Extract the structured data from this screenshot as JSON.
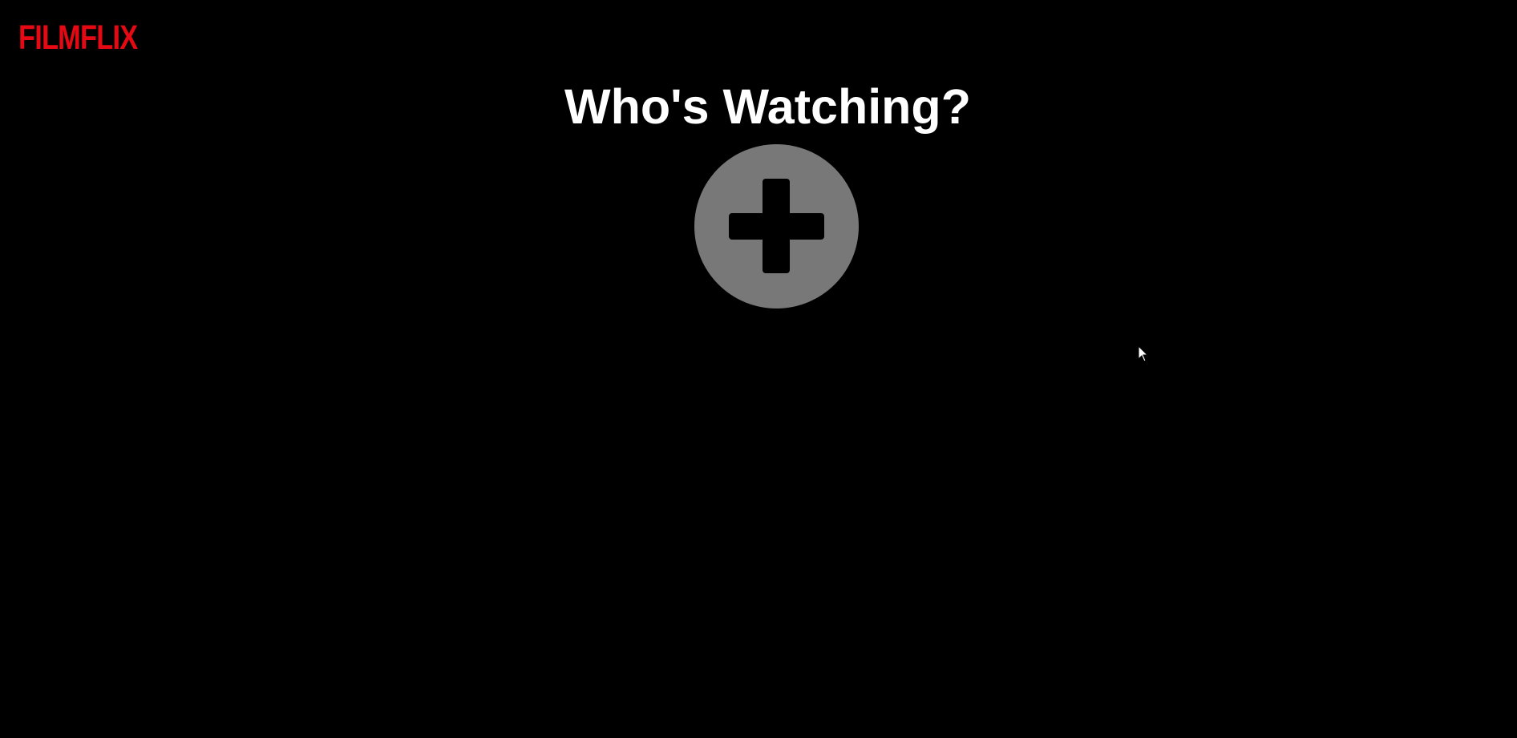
{
  "brand": {
    "logo_text": "FILMFLIX",
    "logo_color": "#e50914"
  },
  "profiles": {
    "heading": "Who's Watching?",
    "add_button": {
      "icon": "plus-icon",
      "color": "#787878"
    }
  },
  "colors": {
    "background": "#000000",
    "heading_text": "#ffffff"
  }
}
